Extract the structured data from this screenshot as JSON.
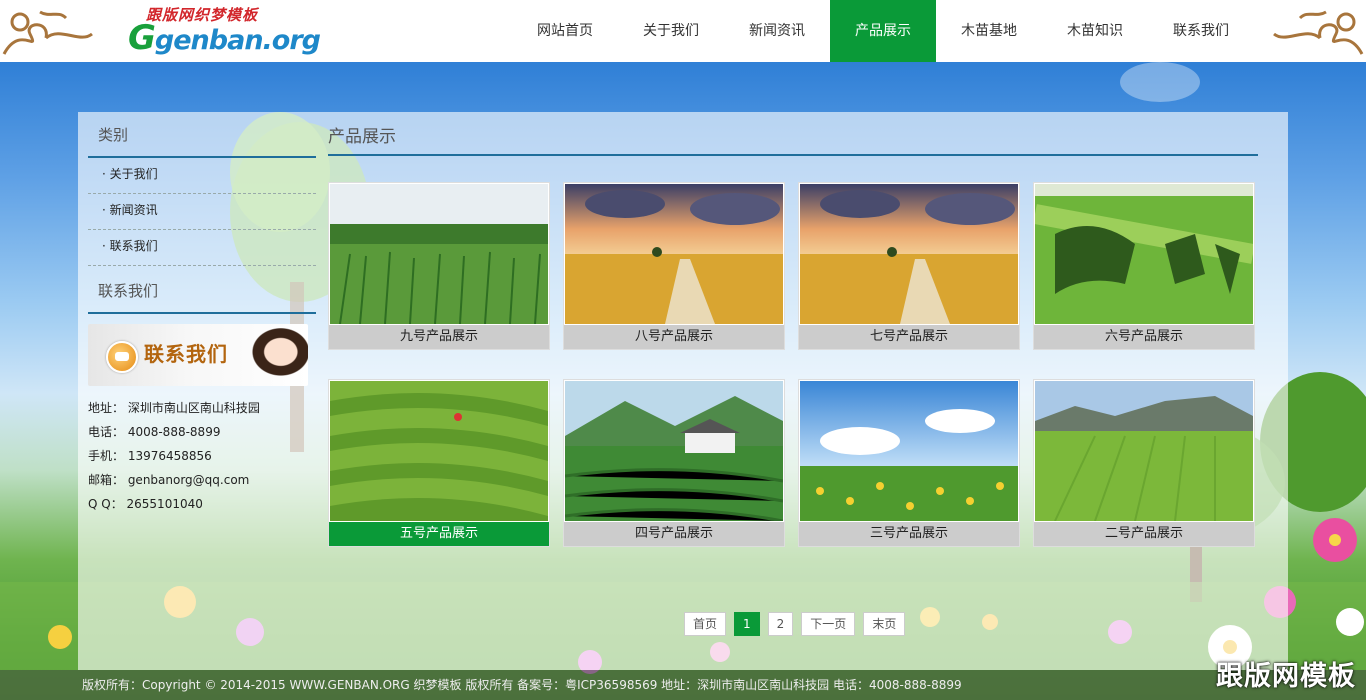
{
  "header": {
    "logo_top": "跟版网织梦模板",
    "logo_bottom_g": "G",
    "logo_bottom_rest": "genban.org"
  },
  "nav": [
    {
      "label": "网站首页"
    },
    {
      "label": "关于我们"
    },
    {
      "label": "新闻资讯"
    },
    {
      "label": "产品展示",
      "active": true
    },
    {
      "label": "木苗基地"
    },
    {
      "label": "木苗知识"
    },
    {
      "label": "联系我们"
    }
  ],
  "sidebar": {
    "category_title": "类别",
    "categories": [
      "关于我们",
      "新闻资讯",
      "联系我们"
    ],
    "contact_title": "联系我们",
    "contact_banner_text": "联系我们",
    "info": [
      "地址： 深圳市南山区南山科技园",
      "电话： 4008-888-8899",
      "手机： 13976458856",
      "邮箱： genbanorg@qq.com",
      "Q Q： 2655101040"
    ]
  },
  "content": {
    "title": "产品展示",
    "products": [
      {
        "caption": "九号产品展示",
        "scene": "corn"
      },
      {
        "caption": "八号产品展示",
        "scene": "wheat"
      },
      {
        "caption": "七号产品展示",
        "scene": "wheat"
      },
      {
        "caption": "六号产品展示",
        "scene": "art"
      },
      {
        "caption": "五号产品展示",
        "scene": "tea",
        "active": true
      },
      {
        "caption": "四号产品展示",
        "scene": "teahouse"
      },
      {
        "caption": "三号产品展示",
        "scene": "flowers"
      },
      {
        "caption": "二号产品展示",
        "scene": "rice"
      }
    ]
  },
  "pager": {
    "first": "首页",
    "pages": [
      "1",
      "2"
    ],
    "current": "1",
    "next": "下一页",
    "last": "末页"
  },
  "footer": {
    "text": "版权所有：Copyright © 2014-2015 WWW.GENBAN.ORG 织梦模板 版权所有   备案号：粤ICP36598569   地址：深圳市南山区南山科技园   电话：4008-888-8899",
    "watermark": "跟版网模板"
  },
  "colors": {
    "accent": "#0a9a38",
    "rule": "#1f6e9b",
    "caption_bg": "#cccccc"
  }
}
